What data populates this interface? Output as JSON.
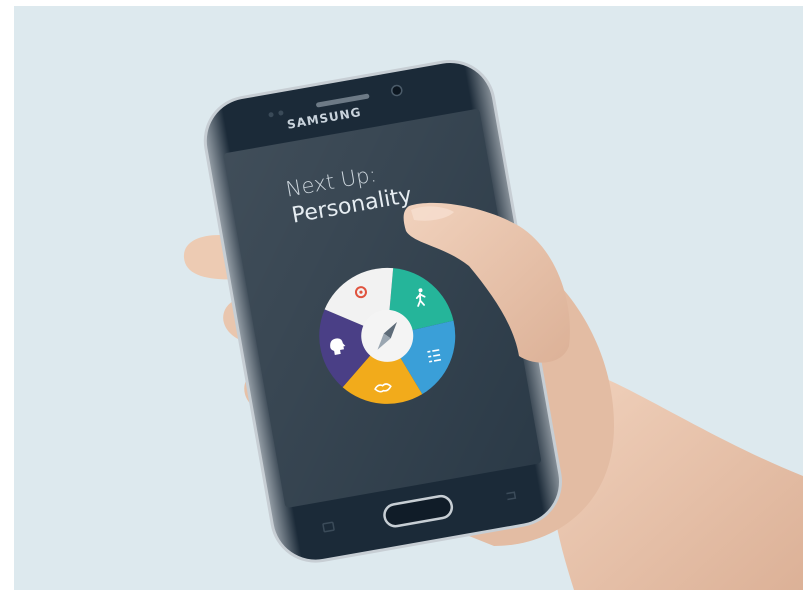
{
  "device": {
    "brand": "SAMSUNG"
  },
  "screen": {
    "heading_line1": "Next Up:",
    "heading_line2": "Personality",
    "wheel": {
      "segments": [
        {
          "icon": "walking-person-icon",
          "color": "#25b59a"
        },
        {
          "icon": "checklist-icon",
          "color": "#3a9fd8"
        },
        {
          "icon": "handshake-icon",
          "color": "#f2ab1b"
        },
        {
          "icon": "head-profile-icon",
          "color": "#4a3f86"
        },
        {
          "icon": "target-icon",
          "color": "#f2f2f2"
        }
      ],
      "center_icon": "compass-needle-icon"
    }
  },
  "colors": {
    "background": "#dde9ee",
    "phone_body": "#1b2a38",
    "screen": "#2b3a47",
    "skin": "#e9c6ae"
  }
}
